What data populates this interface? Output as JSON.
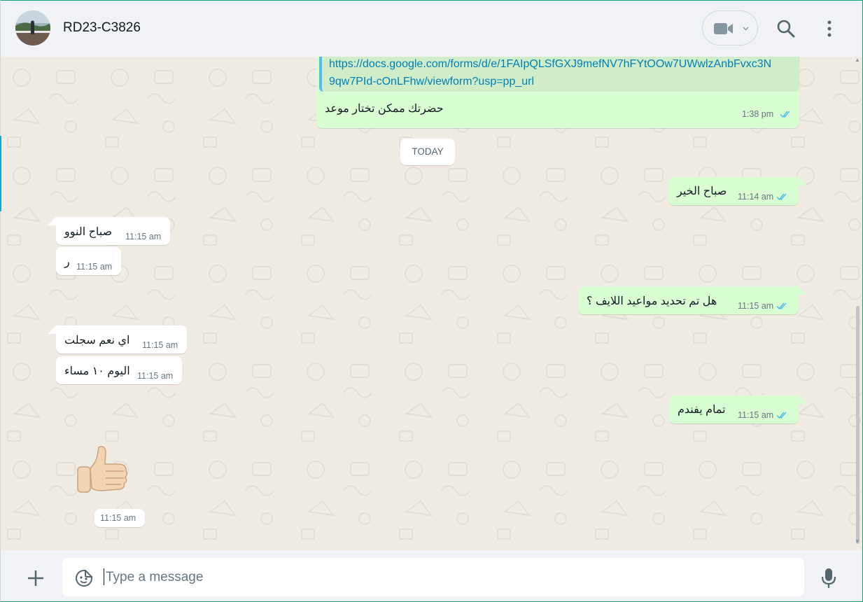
{
  "header": {
    "chat_name": "RD23-C3826",
    "icons": [
      "avatar",
      "video-call-icon",
      "chevron-down-icon",
      "search-icon",
      "menu-icon"
    ]
  },
  "messages": {
    "m1": {
      "direction": "out",
      "link": "https://docs.google.com/forms/d/e/1FAIpQLSfGXJ9mefNV7hFYtOOw7UWwlzAnbFvxc3N",
      "link2": "9qw7PId-cOnLFhw/viewform?usp=pp_url",
      "text": "حضرتك ممكن تختار موعد",
      "time": "1:38 pm",
      "status": "read"
    },
    "date_chip": "TODAY",
    "m2": {
      "direction": "out",
      "text": "صباح الخير",
      "time": "11:14 am",
      "status": "read"
    },
    "m3": {
      "direction": "in",
      "text": "صباح النوو",
      "time": "11:15 am"
    },
    "m4": {
      "direction": "in",
      "text": "ر",
      "time": "11:15 am"
    },
    "m5": {
      "direction": "out",
      "text": "هل تم تحديد مواعيد اللايف ؟",
      "time": "11:15 am",
      "status": "read"
    },
    "m6": {
      "direction": "in",
      "text": "اي نعم سجلت",
      "time": "11:15 am"
    },
    "m7": {
      "direction": "in",
      "text": "اليوم ١٠ مساء",
      "time": "11:15 am"
    },
    "m8": {
      "direction": "out",
      "text": "تمام يفندم",
      "time": "11:15 am",
      "status": "read"
    },
    "m9": {
      "direction": "in",
      "sticker": "thumbs-up",
      "time": "11:15 am"
    }
  },
  "composer": {
    "placeholder": "Type a message",
    "icons": [
      "plus-icon",
      "sticker-icon",
      "microphone-icon"
    ]
  },
  "colors": {
    "outgoing_bubble": "#d9fdd3",
    "incoming_bubble": "#ffffff",
    "chat_background": "#efeae2",
    "read_ticks": "#53bdeb",
    "link": "#027eb5"
  }
}
